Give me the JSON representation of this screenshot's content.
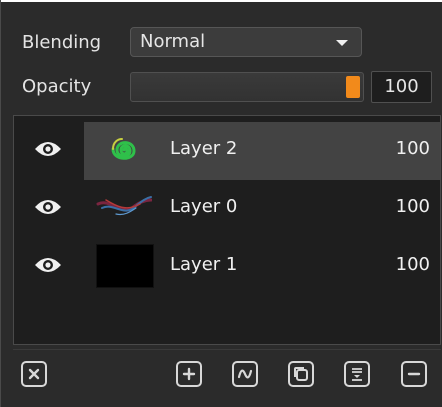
{
  "blending": {
    "label": "Blending",
    "value": "Normal"
  },
  "opacity": {
    "label": "Opacity",
    "value": "100",
    "fraction": 1.0
  },
  "layers": [
    {
      "name": "Layer 2",
      "opacity": "100",
      "selected": true,
      "visible": true,
      "thumb": "green-spiral"
    },
    {
      "name": "Layer 0",
      "opacity": "100",
      "selected": false,
      "visible": true,
      "thumb": "colorful-brush-stroke"
    },
    {
      "name": "Layer 1",
      "opacity": "100",
      "selected": false,
      "visible": true,
      "thumb": "black-fill"
    }
  ],
  "toolbar": [
    "close-icon",
    "add-layer-icon",
    "wave-icon",
    "duplicate-icon",
    "merge-down-icon",
    "remove-layer-icon"
  ],
  "colors": {
    "accent": "#f28a1b",
    "panel": "#2b2b2b",
    "list_bg": "#1e1e1e",
    "selected_row": "#434343"
  }
}
